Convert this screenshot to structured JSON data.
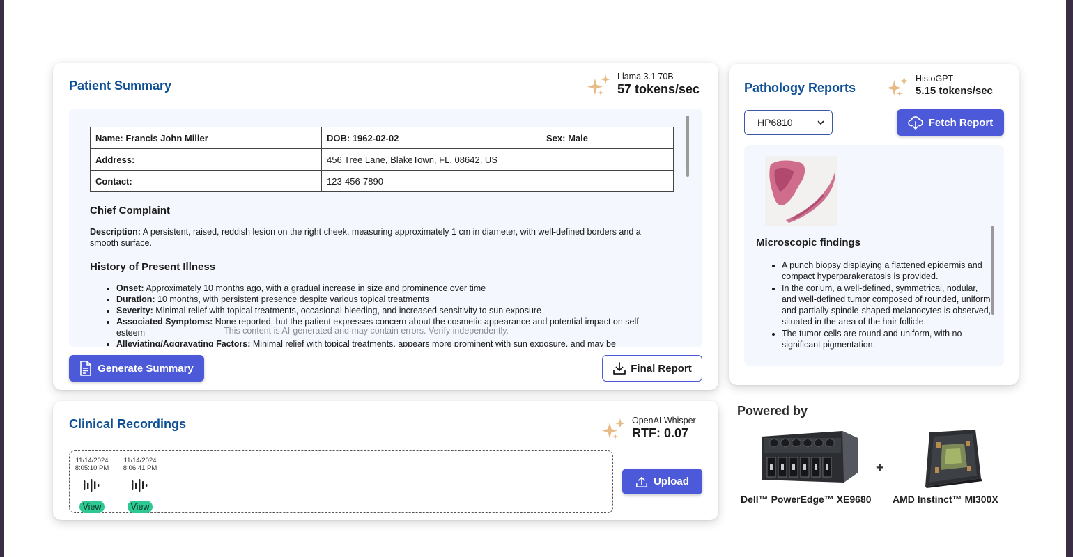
{
  "patient_summary": {
    "title": "Patient Summary",
    "model_name": "Llama 3.1 70B",
    "model_rate": "57 tokens/sec",
    "table": {
      "name": "Name: Francis John Miller",
      "dob": "DOB: 1962-02-02",
      "sex": "Sex: Male",
      "address_label": "Address:",
      "address_value": "456 Tree Lane, BlakeTown, FL, 08642, US",
      "contact_label": "Contact:",
      "contact_value": "123-456-7890"
    },
    "chief_complaint_heading": "Chief Complaint",
    "description_label": "Description:",
    "description_text": "A persistent, raised, reddish lesion on the right cheek, measuring approximately 1 cm in diameter, with well-defined borders and a smooth surface.",
    "hpi_heading": "History of Present Illness",
    "hpi_items": [
      {
        "label": "Onset:",
        "text": "Approximately 10 months ago, with a gradual increase in size and prominence over time"
      },
      {
        "label": "Duration:",
        "text": "10 months, with persistent presence despite various topical treatments"
      },
      {
        "label": "Severity:",
        "text": "Minimal relief with topical treatments, occasional bleeding, and increased sensitivity to sun exposure"
      },
      {
        "label": "Associated Symptoms:",
        "text": "None reported, but the patient expresses concern about the cosmetic appearance and potential impact on self-esteem"
      },
      {
        "label": "Alleviating/Aggravating Factors:",
        "text": "Minimal relief with topical treatments, appears more prominent with sun exposure, and may be"
      }
    ],
    "ai_note": "This content is AI-generated and may contain errors. Verify independently.",
    "generate_label": "Generate Summary",
    "final_label": "Final Report"
  },
  "pathology": {
    "title": "Pathology Reports",
    "model_name": "HistoGPT",
    "model_rate": "5.15 tokens/sec",
    "selected_report": "HP6810",
    "fetch_label": "Fetch Report",
    "findings_heading": "Microscopic findings",
    "findings": [
      "A punch biopsy displaying a flattened epidermis and compact hyperparakeratosis is provided.",
      "In the corium, a well-defined, symmetrical, nodular, and well-defined tumor composed of rounded, uniform, and partially spindle-shaped melanocytes is observed, situated in the area of the hair follicle.",
      "The tumor cells are round and uniform, with no significant pigmentation."
    ]
  },
  "recordings": {
    "title": "Clinical Recordings",
    "model_name": "OpenAI Whisper",
    "model_rate": "RTF: 0.07",
    "items": [
      {
        "date": "11/14/2024",
        "time": "8:05:10 PM",
        "view": "View"
      },
      {
        "date": "11/14/2024",
        "time": "8:06:41 PM",
        "view": "View"
      }
    ],
    "upload_label": "Upload"
  },
  "powered_by": {
    "title": "Powered by",
    "server_label": "Dell™ PowerEdge™ XE9680",
    "plus": "+",
    "gpu_label": "AMD Instinct™ MI300X"
  }
}
